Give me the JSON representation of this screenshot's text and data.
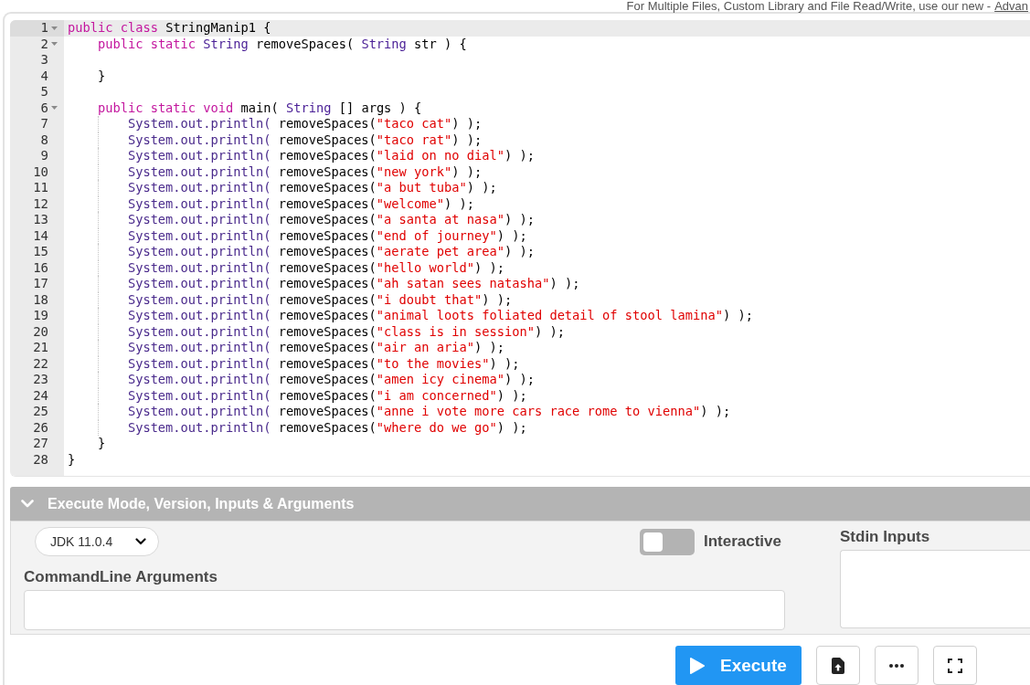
{
  "top_notice": {
    "text": "For Multiple Files, Custom Library and File Read/Write, use our new -",
    "link": "Advan"
  },
  "editor": {
    "lines": [
      {
        "number": "1",
        "active": true,
        "tokens": [
          {
            "kind": "keyword",
            "text": "public class "
          },
          {
            "kind": "plain",
            "text": "StringManip1 {"
          }
        ],
        "children": [
          {
            "number": "2",
            "active": false,
            "tokens": [
              {
                "kind": "keyword",
                "text": "public static "
              },
              {
                "kind": "type",
                "text": "String"
              },
              {
                "kind": "plain",
                "text": " removeSpaces( "
              },
              {
                "kind": "type",
                "text": "String"
              },
              {
                "kind": "plain",
                "text": " str ) {"
              }
            ],
            "children": [
              {
                "number": "3",
                "active": false
              }
            ]
          },
          {
            "number": "4",
            "active": false,
            "tokens": [
              {
                "kind": "plain",
                "text": "}"
              }
            ]
          },
          {
            "number": "5",
            "active": false
          },
          {
            "number": "6",
            "active": false,
            "tokens": [
              {
                "kind": "keyword",
                "text": "public static void "
              },
              {
                "kind": "plain",
                "text": "main( "
              },
              {
                "kind": "type",
                "text": "String"
              },
              {
                "kind": "plain",
                "text": " [] args ) {"
              }
            ],
            "children": [
              {
                "number": "7",
                "active": false,
                "tokens": [
                  {
                    "kind": "support",
                    "text": "System.out.println("
                  },
                  {
                    "kind": "plain",
                    "text": " removeSpaces("
                  },
                  {
                    "kind": "string",
                    "text": "\"taco cat\""
                  },
                  {
                    "kind": "plain",
                    "text": ") );"
                  }
                ]
              },
              {
                "number": "8",
                "active": false,
                "tokens": [
                  {
                    "kind": "support",
                    "text": "System.out.println("
                  },
                  {
                    "kind": "plain",
                    "text": " removeSpaces("
                  },
                  {
                    "kind": "string",
                    "text": "\"taco rat\""
                  },
                  {
                    "kind": "plain",
                    "text": ") );"
                  }
                ]
              },
              {
                "number": "9",
                "active": false,
                "tokens": [
                  {
                    "kind": "support",
                    "text": "System.out.println("
                  },
                  {
                    "kind": "plain",
                    "text": " removeSpaces("
                  },
                  {
                    "kind": "string",
                    "text": "\"laid on no dial\""
                  },
                  {
                    "kind": "plain",
                    "text": ") );"
                  }
                ]
              },
              {
                "number": "10",
                "active": false,
                "tokens": [
                  {
                    "kind": "support",
                    "text": "System.out.println("
                  },
                  {
                    "kind": "plain",
                    "text": " removeSpaces("
                  },
                  {
                    "kind": "string",
                    "text": "\"new york\""
                  },
                  {
                    "kind": "plain",
                    "text": ") );"
                  }
                ]
              },
              {
                "number": "11",
                "active": false,
                "tokens": [
                  {
                    "kind": "support",
                    "text": "System.out.println("
                  },
                  {
                    "kind": "plain",
                    "text": " removeSpaces("
                  },
                  {
                    "kind": "string",
                    "text": "\"a but tuba\""
                  },
                  {
                    "kind": "plain",
                    "text": ") );"
                  }
                ]
              },
              {
                "number": "12",
                "active": false,
                "tokens": [
                  {
                    "kind": "support",
                    "text": "System.out.println("
                  },
                  {
                    "kind": "plain",
                    "text": " removeSpaces("
                  },
                  {
                    "kind": "string",
                    "text": "\"welcome\""
                  },
                  {
                    "kind": "plain",
                    "text": ") );"
                  }
                ]
              },
              {
                "number": "13",
                "active": false,
                "tokens": [
                  {
                    "kind": "support",
                    "text": "System.out.println("
                  },
                  {
                    "kind": "plain",
                    "text": " removeSpaces("
                  },
                  {
                    "kind": "string",
                    "text": "\"a santa at nasa\""
                  },
                  {
                    "kind": "plain",
                    "text": ") );"
                  }
                ]
              },
              {
                "number": "14",
                "active": false,
                "tokens": [
                  {
                    "kind": "support",
                    "text": "System.out.println("
                  },
                  {
                    "kind": "plain",
                    "text": " removeSpaces("
                  },
                  {
                    "kind": "string",
                    "text": "\"end of journey\""
                  },
                  {
                    "kind": "plain",
                    "text": ") );"
                  }
                ]
              },
              {
                "number": "15",
                "active": false,
                "tokens": [
                  {
                    "kind": "support",
                    "text": "System.out.println("
                  },
                  {
                    "kind": "plain",
                    "text": " removeSpaces("
                  },
                  {
                    "kind": "string",
                    "text": "\"aerate pet area\""
                  },
                  {
                    "kind": "plain",
                    "text": ") );"
                  }
                ]
              },
              {
                "number": "16",
                "active": false,
                "tokens": [
                  {
                    "kind": "support",
                    "text": "System.out.println("
                  },
                  {
                    "kind": "plain",
                    "text": " removeSpaces("
                  },
                  {
                    "kind": "string",
                    "text": "\"hello world\""
                  },
                  {
                    "kind": "plain",
                    "text": ") );"
                  }
                ]
              },
              {
                "number": "17",
                "active": false,
                "tokens": [
                  {
                    "kind": "support",
                    "text": "System.out.println("
                  },
                  {
                    "kind": "plain",
                    "text": " removeSpaces("
                  },
                  {
                    "kind": "string",
                    "text": "\"ah satan sees natasha\""
                  },
                  {
                    "kind": "plain",
                    "text": ") );"
                  }
                ]
              },
              {
                "number": "18",
                "active": false,
                "tokens": [
                  {
                    "kind": "support",
                    "text": "System.out.println("
                  },
                  {
                    "kind": "plain",
                    "text": " removeSpaces("
                  },
                  {
                    "kind": "string",
                    "text": "\"i doubt that\""
                  },
                  {
                    "kind": "plain",
                    "text": ") );"
                  }
                ]
              },
              {
                "number": "19",
                "active": false,
                "tokens": [
                  {
                    "kind": "support",
                    "text": "System.out.println("
                  },
                  {
                    "kind": "plain",
                    "text": " removeSpaces("
                  },
                  {
                    "kind": "string",
                    "text": "\"animal loots foliated detail of stool lamina\""
                  },
                  {
                    "kind": "plain",
                    "text": ") );"
                  }
                ]
              },
              {
                "number": "20",
                "active": false,
                "tokens": [
                  {
                    "kind": "support",
                    "text": "System.out.println("
                  },
                  {
                    "kind": "plain",
                    "text": " removeSpaces("
                  },
                  {
                    "kind": "string",
                    "text": "\"class is in session\""
                  },
                  {
                    "kind": "plain",
                    "text": ") );"
                  }
                ]
              },
              {
                "number": "21",
                "active": false,
                "tokens": [
                  {
                    "kind": "support",
                    "text": "System.out.println("
                  },
                  {
                    "kind": "plain",
                    "text": " removeSpaces("
                  },
                  {
                    "kind": "string",
                    "text": "\"air an aria\""
                  },
                  {
                    "kind": "plain",
                    "text": ") );"
                  }
                ]
              },
              {
                "number": "22",
                "active": false,
                "tokens": [
                  {
                    "kind": "support",
                    "text": "System.out.println("
                  },
                  {
                    "kind": "plain",
                    "text": " removeSpaces("
                  },
                  {
                    "kind": "string",
                    "text": "\"to the movies\""
                  },
                  {
                    "kind": "plain",
                    "text": ") );"
                  }
                ]
              },
              {
                "number": "23",
                "active": false,
                "tokens": [
                  {
                    "kind": "support",
                    "text": "System.out.println("
                  },
                  {
                    "kind": "plain",
                    "text": " removeSpaces("
                  },
                  {
                    "kind": "string",
                    "text": "\"amen icy cinema\""
                  },
                  {
                    "kind": "plain",
                    "text": ") );"
                  }
                ]
              },
              {
                "number": "24",
                "active": false,
                "tokens": [
                  {
                    "kind": "support",
                    "text": "System.out.println("
                  },
                  {
                    "kind": "plain",
                    "text": " removeSpaces("
                  },
                  {
                    "kind": "string",
                    "text": "\"i am concerned\""
                  },
                  {
                    "kind": "plain",
                    "text": ") );"
                  }
                ]
              },
              {
                "number": "25",
                "active": false,
                "tokens": [
                  {
                    "kind": "support",
                    "text": "System.out.println("
                  },
                  {
                    "kind": "plain",
                    "text": " removeSpaces("
                  },
                  {
                    "kind": "string",
                    "text": "\"anne i vote more cars race rome to vienna\""
                  },
                  {
                    "kind": "plain",
                    "text": ") );"
                  }
                ]
              },
              {
                "number": "26",
                "active": false,
                "tokens": [
                  {
                    "kind": "support",
                    "text": "System.out.println("
                  },
                  {
                    "kind": "plain",
                    "text": " removeSpaces("
                  },
                  {
                    "kind": "string",
                    "text": "\"where do we go\""
                  },
                  {
                    "kind": "plain",
                    "text": ") );"
                  }
                ]
              }
            ]
          },
          {
            "number": "27",
            "active": false,
            "tokens": [
              {
                "kind": "plain",
                "text": "}"
              }
            ]
          }
        ]
      },
      {
        "number": "28",
        "active": false,
        "tokens": [
          {
            "kind": "plain",
            "text": "}"
          }
        ]
      }
    ]
  },
  "execute_panel": {
    "title": "Execute Mode, Version, Inputs & Arguments",
    "expanded": true,
    "version": "JDK 11.0.4",
    "interactive": {
      "label": "Interactive",
      "on": false
    },
    "stdin": {
      "label": "Stdin Inputs"
    },
    "arguments": {
      "label": "CommandLine Arguments"
    }
  },
  "actions": [
    {
      "kind": "execute",
      "label": "Execute"
    },
    {
      "kind": "upload"
    },
    {
      "kind": "more"
    },
    {
      "kind": "fullscreen"
    }
  ]
}
